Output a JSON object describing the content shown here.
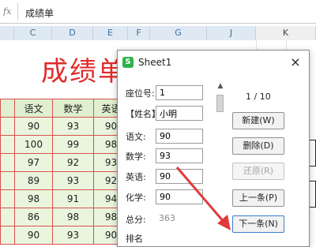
{
  "formula_bar": {
    "fx_label": "fx",
    "value": "成绩单"
  },
  "columns": [
    "C",
    "D",
    "E",
    "F",
    "G",
    "J",
    "K"
  ],
  "sheet": {
    "title": "成绩单",
    "headers": [
      "语文",
      "数学",
      "英语"
    ],
    "rows": [
      [
        "90",
        "93",
        "90"
      ],
      [
        "100",
        "99",
        "98"
      ],
      [
        "97",
        "92",
        "93"
      ],
      [
        "89",
        "93",
        "92"
      ],
      [
        "98",
        "91",
        "94"
      ],
      [
        "86",
        "98",
        "98"
      ],
      [
        "90",
        "93",
        "90"
      ]
    ]
  },
  "dialog": {
    "title": "Sheet1",
    "app_icon": "S",
    "close_icon": "×",
    "fields": [
      {
        "label": "座位号:",
        "value": "1"
      },
      {
        "label": "【姓名】:",
        "value": "小明"
      },
      {
        "label": "语文:",
        "value": "90"
      },
      {
        "label": "数学:",
        "value": "93"
      },
      {
        "label": "英语:",
        "value": "90"
      },
      {
        "label": "化学:",
        "value": "90"
      }
    ],
    "total_label": "总分:",
    "total_value": "363",
    "rank_label": "排名",
    "record_count": "1 / 10",
    "buttons": {
      "new": "新建(W)",
      "delete": "删除(D)",
      "restore": "还原(R)",
      "prev": "上一条(P)",
      "next": "下一条(N)"
    }
  },
  "annotation": {
    "color": "#e23a3a"
  }
}
